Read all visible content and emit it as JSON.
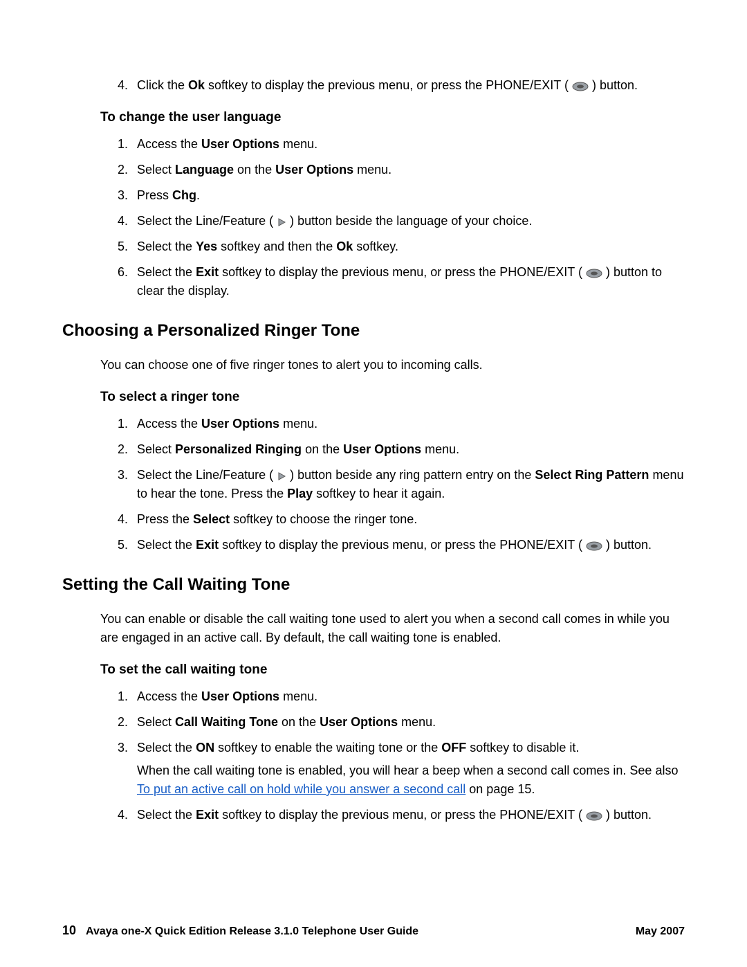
{
  "step4_top": {
    "num": "4",
    "pre": "Click the ",
    "ok": "Ok",
    "mid": " softkey to display the previous menu, or press the PHONE/EXIT (",
    "post": ") button."
  },
  "subhead_lang": "To change the user language",
  "lang_steps": {
    "s1": {
      "pre": "Access the ",
      "b": "User Options",
      "post": " menu."
    },
    "s2": {
      "pre": "Select ",
      "b1": "Language",
      "mid": " on the ",
      "b2": "User Options",
      "post": " menu."
    },
    "s3": {
      "pre": "Press ",
      "b": "Chg",
      "post": "."
    },
    "s4": {
      "pre": "Select the Line/Feature (",
      "post": ") button beside the language of your choice."
    },
    "s5": {
      "pre": "Select the ",
      "b1": "Yes",
      "mid": " softkey and then the ",
      "b2": "Ok",
      "post": " softkey."
    },
    "s6": {
      "pre": "Select the ",
      "b": "Exit",
      "mid": " softkey to display the previous menu, or press the PHONE/EXIT (",
      "post": ") button to clear the display."
    }
  },
  "h2_ringer": "Choosing a Personalized Ringer Tone",
  "para_ringer": "You can choose one of five ringer tones to alert you to incoming calls.",
  "subhead_ringer": "To select a ringer tone",
  "ringer_steps": {
    "s1": {
      "pre": "Access the ",
      "b": "User Options",
      "post": " menu."
    },
    "s2": {
      "pre": "Select ",
      "b1": "Personalized Ringing",
      "mid": " on the ",
      "b2": "User Options",
      "post": " menu."
    },
    "s3": {
      "pre": "Select the Line/Feature (",
      "mid1": ") button beside any ring pattern entry on the ",
      "b1": "Select Ring Pattern",
      "mid2": " menu to hear the tone. Press the ",
      "b2": "Play",
      "post": " softkey to hear it again."
    },
    "s4": {
      "pre": "Press the ",
      "b": "Select",
      "post": " softkey to choose the ringer tone."
    },
    "s5": {
      "pre": "Select the ",
      "b": "Exit",
      "mid": " softkey to display the previous menu, or press the PHONE/EXIT (",
      "post": ") button."
    }
  },
  "h2_callwait": "Setting the Call Waiting Tone",
  "para_callwait": "You can enable or disable the call waiting tone used to alert you when a second call comes in while you are engaged in an active call. By default, the call waiting tone is enabled.",
  "subhead_callwait": "To set the call waiting tone",
  "callwait_steps": {
    "s1": {
      "pre": "Access the ",
      "b": "User Options",
      "post": " menu."
    },
    "s2": {
      "pre": "Select ",
      "b1": "Call Waiting Tone",
      "mid": " on the ",
      "b2": "User Options",
      "post": " menu."
    },
    "s3": {
      "pre": "Select the ",
      "b1": "ON",
      "mid": " softkey to enable the waiting tone or the ",
      "b2": "OFF",
      "post": " softkey to disable it."
    },
    "s3_extra": {
      "pre": "When the call waiting tone is enabled, you will hear a beep when a second call comes in. See also ",
      "link": "To put an active call on hold while you answer a second call",
      "post": " on page 15."
    },
    "s4": {
      "pre": "Select the ",
      "b": "Exit",
      "mid": " softkey to display the previous menu, or press the PHONE/EXIT (",
      "post": ") button."
    }
  },
  "footer": {
    "page": "10",
    "title": "Avaya one-X Quick Edition Release 3.1.0 Telephone User Guide",
    "date": "May 2007"
  }
}
